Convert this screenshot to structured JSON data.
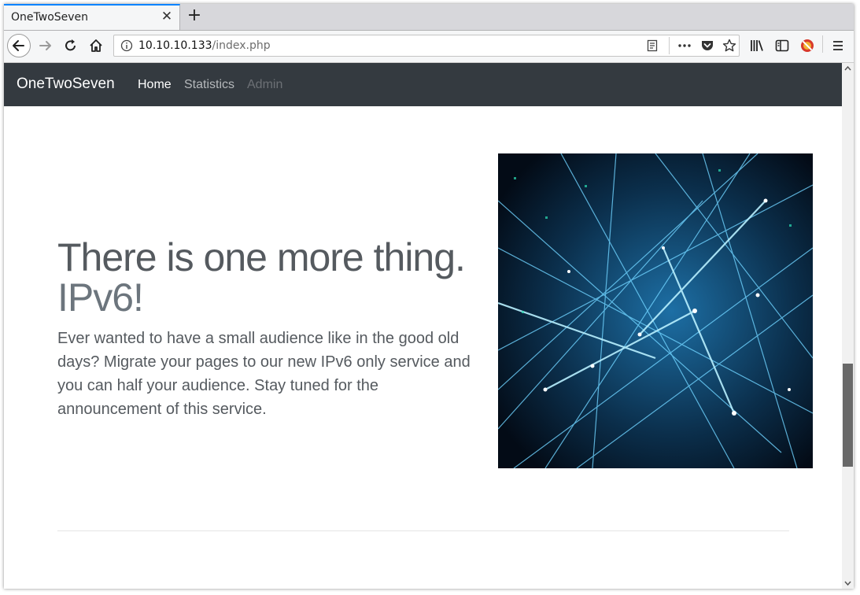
{
  "browser": {
    "tab_title": "OneTwoSeven",
    "tab_close_glyph": "✕",
    "new_tab_glyph": "+",
    "url_host": "10.10.10.133",
    "url_path": "/index.php",
    "icons": [
      "back-icon",
      "forward-icon",
      "reload-icon",
      "home-icon",
      "site-info-icon",
      "reader-view-icon",
      "page-actions-icon",
      "pocket-icon",
      "bookmark-star-icon",
      "library-icon",
      "sidebar-icon",
      "noscript-icon",
      "menu-icon"
    ]
  },
  "navbar": {
    "brand": "OneTwoSeven",
    "links": [
      {
        "label": "Home",
        "color": "#ffffff"
      },
      {
        "label": "Statistics",
        "color": "#b5b8bb"
      },
      {
        "label": "Admin",
        "color": "#6c7075"
      }
    ]
  },
  "hero": {
    "headline_line1": "There is one more thing.",
    "headline_line2": "IPv6!",
    "lead": "Ever wanted to have a small audience like in the good old days? Migrate your pages to our new IPv6 only service and you can half your audience. Stay tuned for the announcement of this service."
  },
  "colors": {
    "navbar_bg": "#343a40",
    "accent_tab": "#0a84ff"
  }
}
